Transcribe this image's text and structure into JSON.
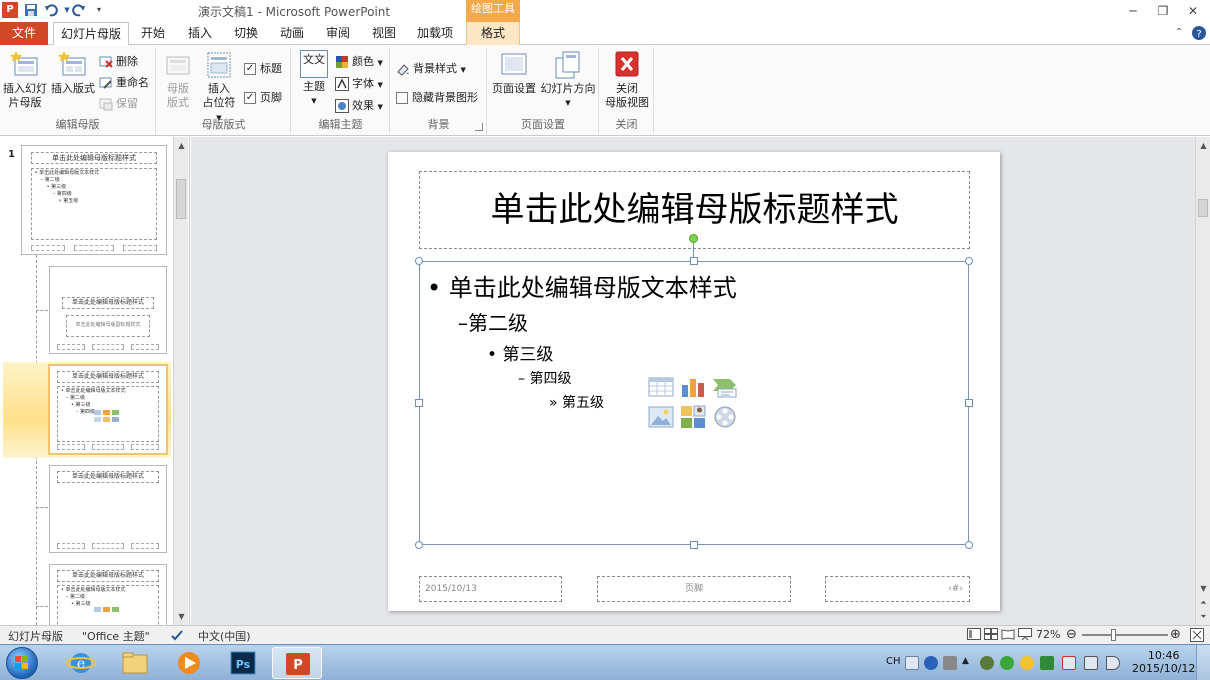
{
  "window": {
    "app_icon": "P",
    "title": "演示文稿1 - Microsoft PowerPoint",
    "tools_context_label": "绘图工具"
  },
  "tabs": [
    {
      "label": "文件"
    },
    {
      "label": "幻灯片母版"
    },
    {
      "label": "开始"
    },
    {
      "label": "插入"
    },
    {
      "label": "切换"
    },
    {
      "label": "动画"
    },
    {
      "label": "审阅"
    },
    {
      "label": "视图"
    },
    {
      "label": "加载项"
    },
    {
      "label": "格式"
    }
  ],
  "ribbon": {
    "edit_master": {
      "label": "编辑母版",
      "insert_slide_master": "插入幻灯片母版",
      "insert_slide_master_l1": "插入幻灯",
      "insert_slide_master_l2": "片母版",
      "insert_layout": "插入版式",
      "delete": "删除",
      "rename": "重命名",
      "preserve": "保留"
    },
    "master_layout": {
      "label": "母版版式",
      "master_layout_l1": "母版",
      "master_layout_l2": "版式",
      "insert_placeholder_l1": "插入",
      "insert_placeholder_l2": "占位符",
      "title_check": "标题",
      "footer_check": "页脚"
    },
    "edit_theme": {
      "label": "编辑主题",
      "themes": "主题",
      "theme_icon_text": "文文",
      "colors": "颜色",
      "fonts": "字体",
      "effects": "效果"
    },
    "background": {
      "label": "背景",
      "background_styles": "背景样式",
      "hide_background": "隐藏背景图形"
    },
    "page_setup": {
      "label": "页面设置",
      "page_setup": "页面设置",
      "orientation": "幻灯片方向"
    },
    "close": {
      "label": "关闭",
      "close_l1": "关闭",
      "close_l2": "母版视图"
    }
  },
  "thumbnails": {
    "number_1": "1",
    "title_text": "单击此处编辑母版标题样式",
    "body_l1": "• 单击此处编辑母版文本样式",
    "body_l2": "– 第二级",
    "body_l3": "• 第三级",
    "body_l4": "– 第四级",
    "body_l5": "» 第五级",
    "subtitle_text": "单击此处编辑母版副标题样式"
  },
  "slide": {
    "title": "单击此处编辑母版标题样式",
    "level1": "单击此处编辑母版文本样式",
    "level2": "第二级",
    "level3": "第三级",
    "level4": "第四级",
    "level5": "第五级",
    "bullet1": "•",
    "bullet2": "–",
    "bullet3": "•",
    "bullet4": "–",
    "bullet5": "»",
    "footer_date": "2015/10/13",
    "footer_text": "页脚",
    "footer_number": "‹#›"
  },
  "status": {
    "view": "幻灯片母版",
    "theme": "\"Office 主题\"",
    "language": "中文(中国)",
    "zoom": "72%"
  },
  "taskbar": {
    "ime": "CH",
    "time": "10:46",
    "date": "2015/10/12"
  },
  "colors": {
    "file_tab": "#d24726",
    "tool_context": "#f5a94a",
    "selection_border": "#f0c46a",
    "rotate_handle": "#7fd04b"
  }
}
